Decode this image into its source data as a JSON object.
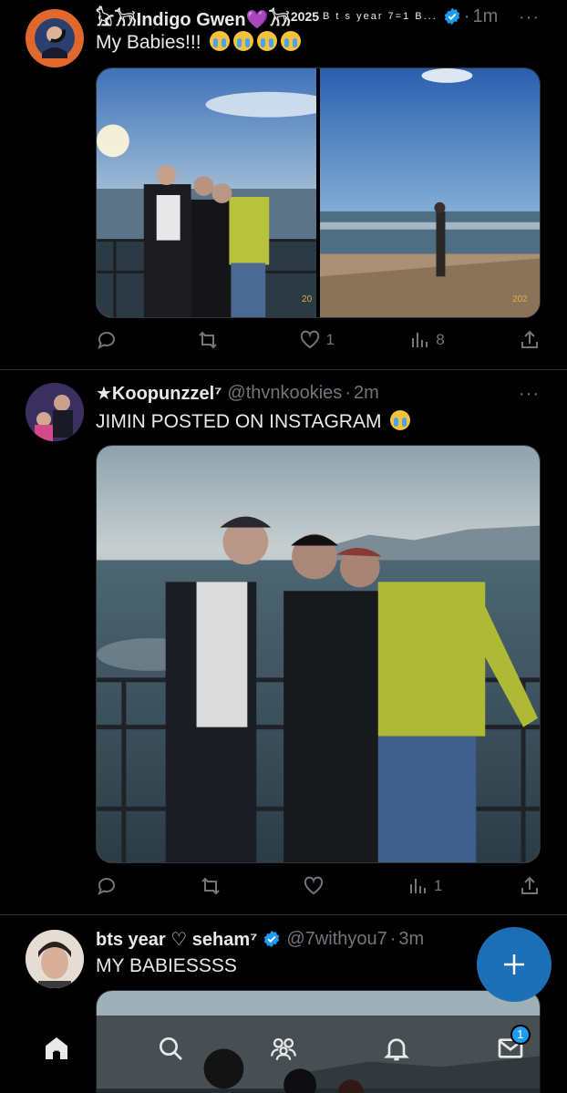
{
  "tweets": [
    {
      "name": "𓃠𓃡Indigo Gwen💜𓃡",
      "name_suffix": "2025",
      "name_small": "B t s year 7=1 B...",
      "time": "1m",
      "text": "My Babies!!!",
      "replies": "",
      "retweets": "",
      "likes": "1",
      "views": "8",
      "photo_years": [
        "20",
        "202"
      ]
    },
    {
      "name": "★Koopunzzel⁷",
      "handle": "@thvnkookies",
      "time": "2m",
      "text": "JIMIN POSTED ON INSTAGRAM",
      "replies": "",
      "retweets": "",
      "likes": "",
      "views": "1"
    },
    {
      "name": "bts year ♡ seham⁷",
      "handle": "@7withyou7",
      "time": "3m",
      "text": "MY BABIESSSS"
    }
  ],
  "nav": {
    "messages_badge": "1"
  },
  "icons": {
    "more": "···",
    "dot": "·",
    "plus": "+"
  },
  "colors": {
    "accent": "#1d9bf0",
    "muted": "#71767b"
  }
}
